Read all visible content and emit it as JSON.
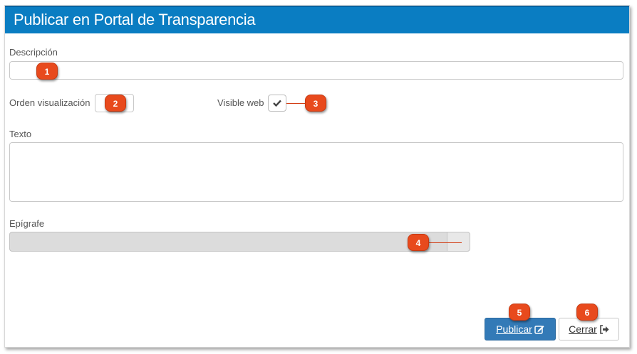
{
  "dialog": {
    "title": "Publicar en Portal de Transparencia"
  },
  "form": {
    "descripcion_label": "Descripción",
    "descripcion_value": "",
    "orden_label": "Orden visualización",
    "orden_value": "",
    "visible_label": "Visible web",
    "visible_checked": true,
    "texto_label": "Texto",
    "texto_value": "",
    "epigrafe_label": "Epígrafe",
    "epigrafe_value": ""
  },
  "buttons": {
    "publicar_label": "Publicar",
    "cerrar_label": "Cerrar"
  },
  "callouts": [
    "1",
    "2",
    "3",
    "4",
    "5",
    "6"
  ],
  "colors": {
    "title_bar": "#0a7dc2",
    "primary_button": "#337ab7",
    "callout": "#e84a1d"
  }
}
